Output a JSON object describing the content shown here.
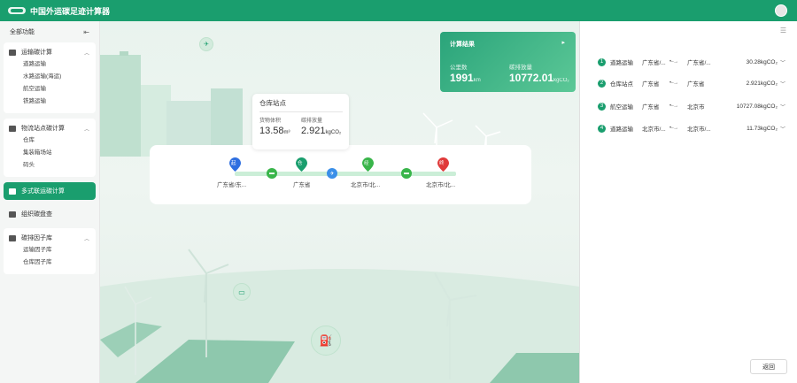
{
  "header": {
    "title": "中国外运碳足迹计算器"
  },
  "sidebar": {
    "all_label": "全部功能",
    "groups": [
      {
        "title": "运输碳计算",
        "items": [
          "道路运输",
          "水路运输(海运)",
          "航空运输",
          "铁路运输"
        ]
      },
      {
        "title": "物流站点碳计算",
        "items": [
          "仓库",
          "集装箱场站",
          "码头"
        ]
      }
    ],
    "active": "多式联运碳计算",
    "plain": "组织碳盘查",
    "library": {
      "title": "碳排因子库",
      "items": [
        "运输因子库",
        "仓库因子库"
      ]
    }
  },
  "result_card": {
    "title": "计算结果",
    "distance_label": "公里数",
    "distance_value": "1991",
    "distance_unit": "km",
    "emission_label": "碳排放量",
    "emission_value": "10772.01",
    "emission_unit": "kgCO₂"
  },
  "tooltip": {
    "title": "仓库站点",
    "volume_label": "货物体积",
    "volume_value": "13.58",
    "volume_unit": "m³",
    "emission_label": "碳排放量",
    "emission_value": "2.921",
    "emission_unit": "kgCO₂"
  },
  "route": {
    "nodes": [
      {
        "badge": "起",
        "label": "广东省/东...",
        "color": "#2f6fe0"
      },
      {
        "badge": "仓",
        "label": "广东省",
        "color": "#1a9e6e"
      },
      {
        "badge": "经",
        "label": "北京市/北...",
        "color": "#39b54a"
      },
      {
        "badge": "终",
        "label": "北京市/北...",
        "color": "#e03a3a"
      }
    ],
    "modes": [
      "truck",
      "plane",
      "truck"
    ]
  },
  "legs": [
    {
      "num": "1",
      "type": "道路运输",
      "from": "广东省/...",
      "to": "广东省/...",
      "value": "30.28kgCO₂"
    },
    {
      "num": "2",
      "type": "仓库站点",
      "from": "广东省",
      "to": "广东省",
      "value": "2.921kgCO₂"
    },
    {
      "num": "3",
      "type": "航空运输",
      "from": "广东省",
      "to": "北京市",
      "value": "10727.08kgCO₂"
    },
    {
      "num": "4",
      "type": "道路运输",
      "from": "北京市/...",
      "to": "北京市/...",
      "value": "11.73kgCO₂"
    }
  ],
  "back_label": "返回",
  "colors": {
    "brand": "#1a9e6e"
  }
}
